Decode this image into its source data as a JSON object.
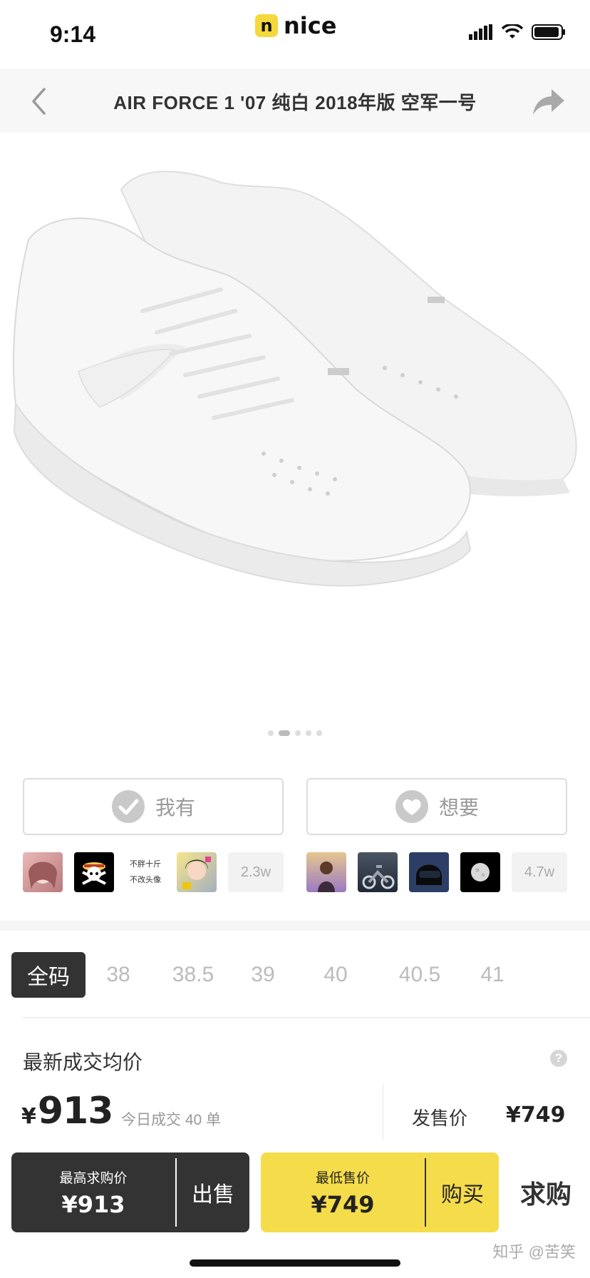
{
  "status_bar": {
    "time": "9:14",
    "brand_badge": "n",
    "brand_name": "nice",
    "brand_color": "#f5d83a"
  },
  "header": {
    "back_icon": "chevron-left-icon",
    "title": "AIR FORCE 1 '07 纯白 2018年版 空军一号",
    "share_icon": "share-arrow-icon"
  },
  "gallery": {
    "image": "white-sneakers-photo",
    "page_count": 5,
    "active_page": 2
  },
  "own": {
    "label": "我有",
    "icon": "check-circle-icon",
    "avatars": [
      "avatar-anime-girl",
      "avatar-pirate-skull",
      "avatar-text",
      "avatar-girl-portrait"
    ],
    "avatar_text_lines": [
      "不胖十斤",
      "不改头像"
    ],
    "count": "2.3w"
  },
  "want": {
    "label": "想要",
    "icon": "heart-icon",
    "avatars": [
      "avatar-sunset-person",
      "avatar-motorcycle",
      "avatar-helmet",
      "avatar-moon"
    ],
    "count": "4.7w"
  },
  "sizes": {
    "items": [
      "全码",
      "38",
      "38.5",
      "39",
      "40",
      "40.5",
      "41"
    ],
    "active": 0
  },
  "price": {
    "avg_title": "最新成交均价",
    "currency": "¥",
    "avg_value": "913",
    "today_text": "今日成交 40 单",
    "release_label": "发售价",
    "release_price": "¥749"
  },
  "bottom": {
    "bid_label": "最高求购价",
    "bid_price": "¥913",
    "sell_label": "出售",
    "ask_label": "最低售价",
    "ask_price": "¥749",
    "buy_label": "购买",
    "seek_label": "求购",
    "ask_color": "#f5dc4a",
    "bid_color": "#333333"
  },
  "watermark": "知乎 @苦笑"
}
